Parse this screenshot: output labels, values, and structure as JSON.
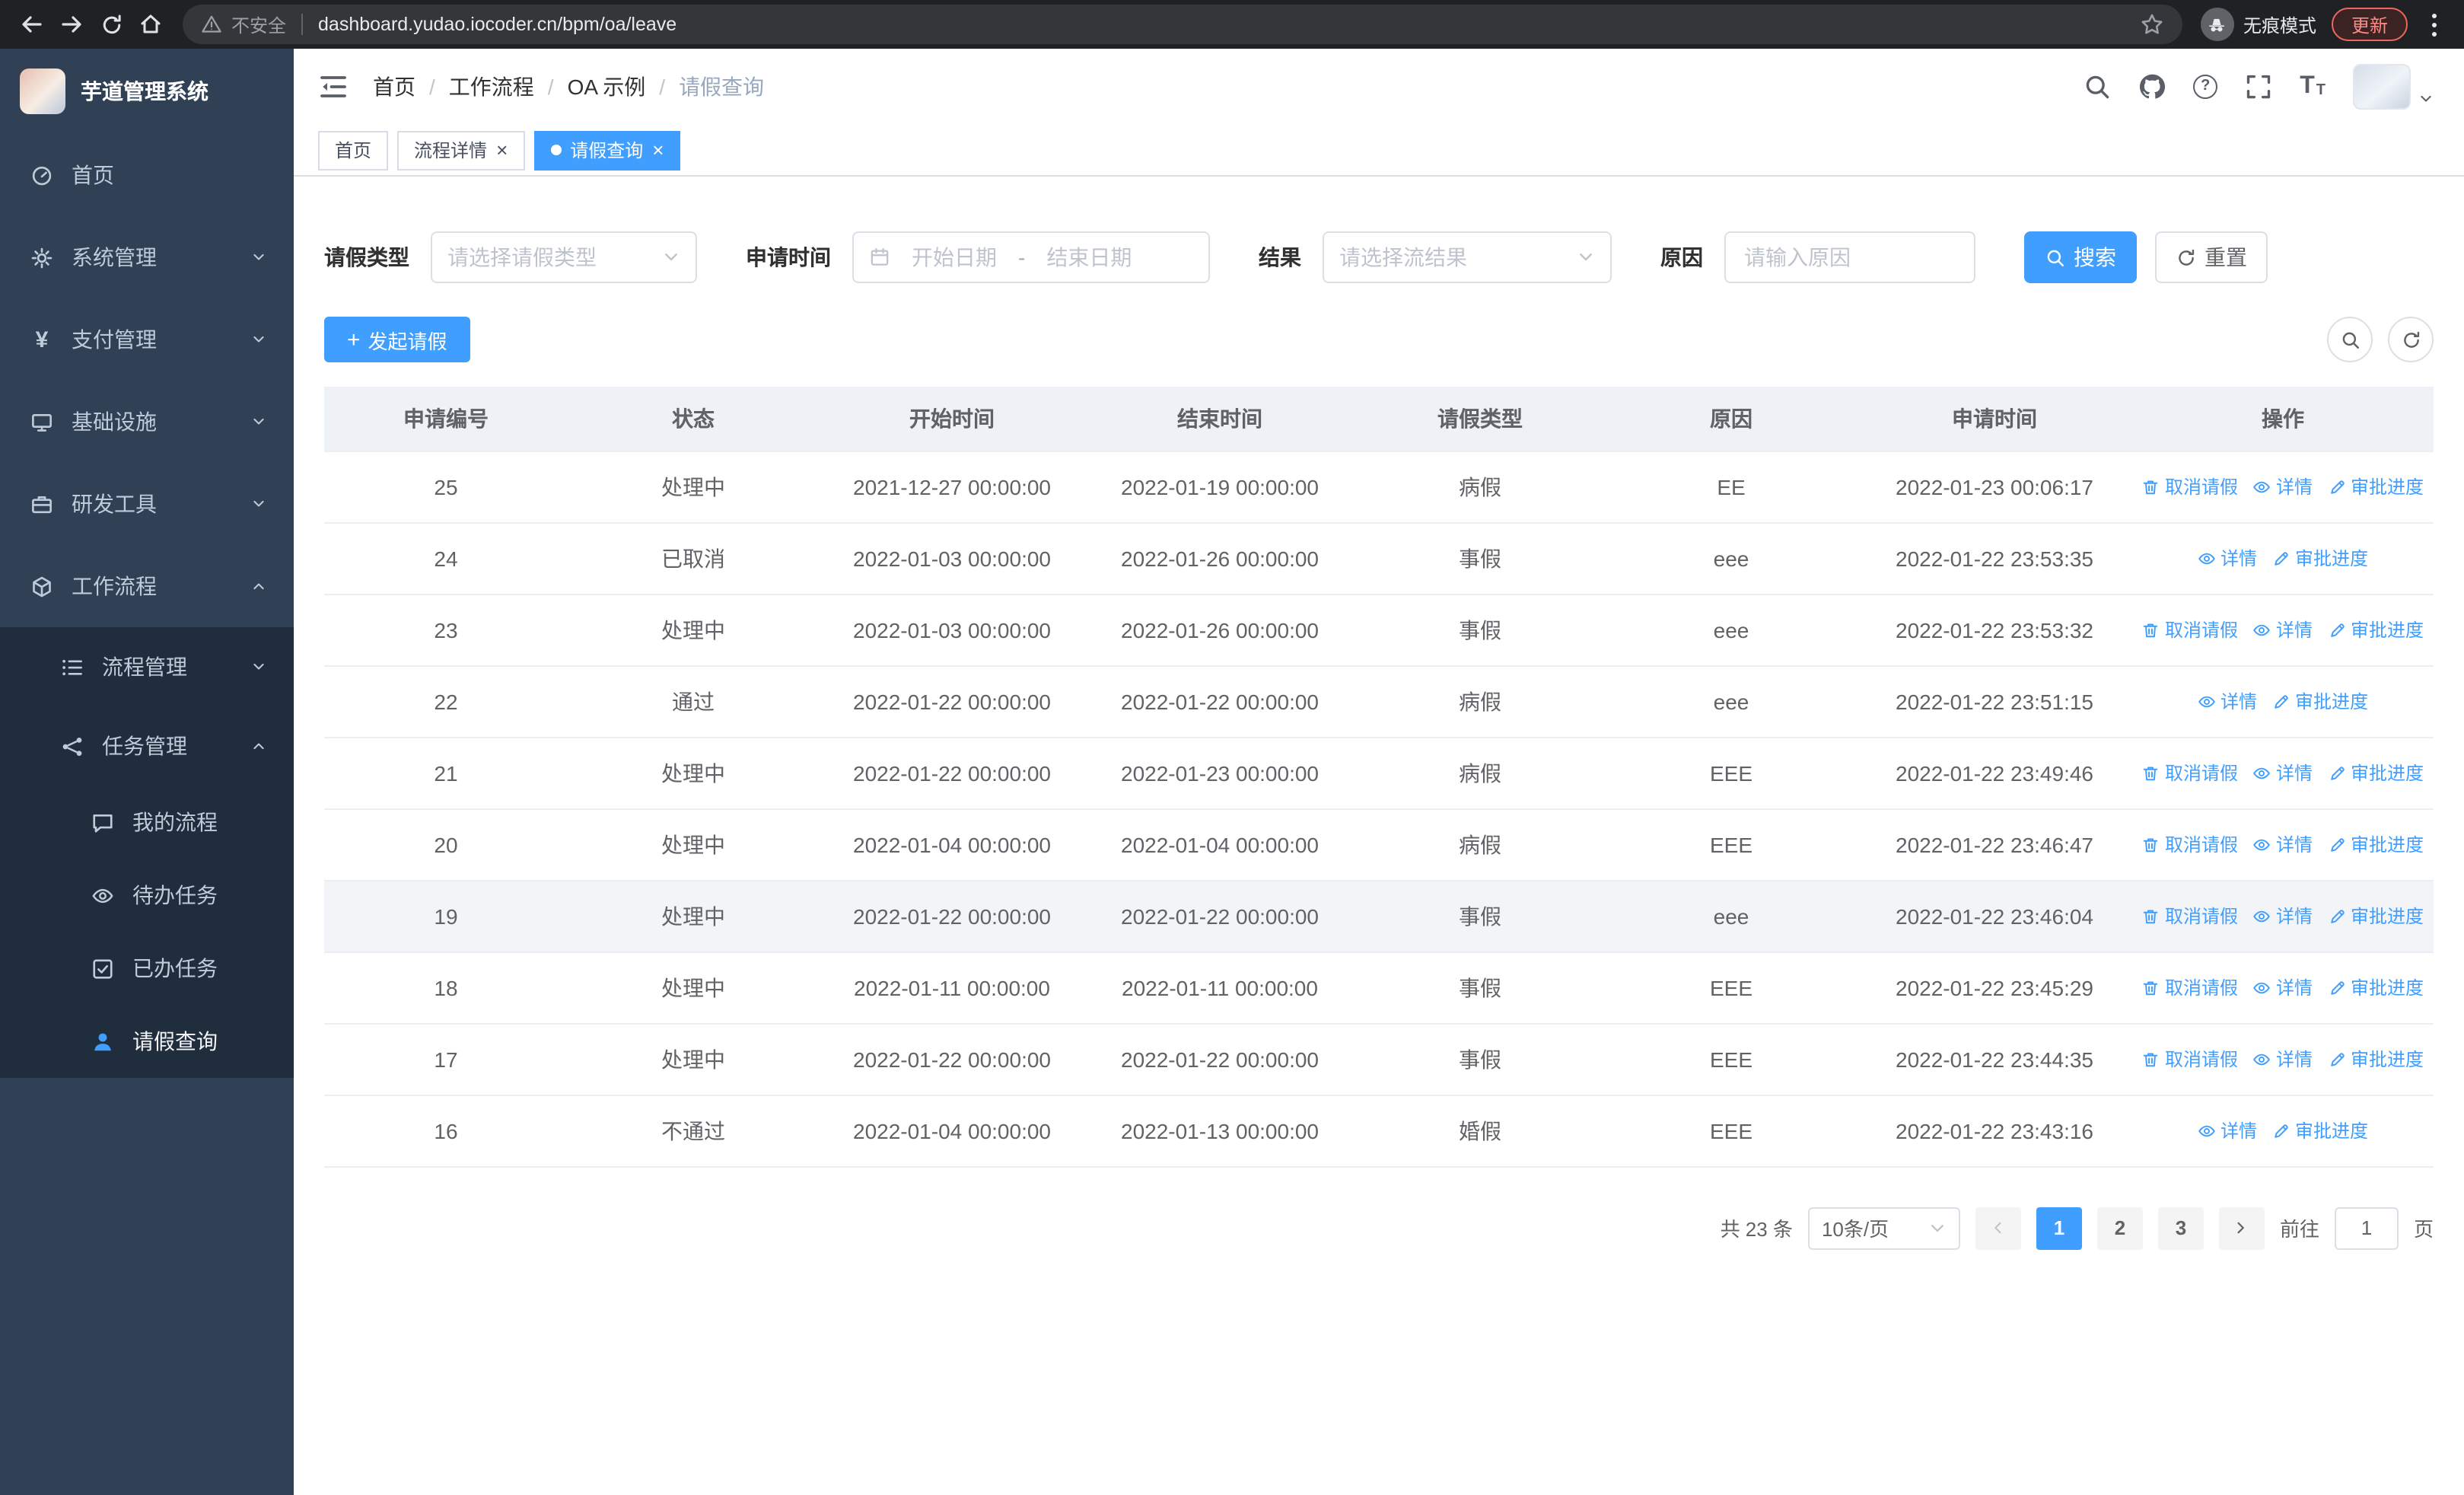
{
  "browser": {
    "security_label": "不安全",
    "url": "dashboard.yudao.iocoder.cn/bpm/oa/leave",
    "incognito_label": "无痕模式",
    "update_label": "更新"
  },
  "sidebar": {
    "brand": "芋道管理系统",
    "items": {
      "home": "首页",
      "system": "系统管理",
      "payment": "支付管理",
      "infra": "基础设施",
      "devtools": "研发工具",
      "workflow": "工作流程",
      "process_mgmt": "流程管理",
      "task_mgmt": "任务管理",
      "my_process": "我的流程",
      "todo_tasks": "待办任务",
      "done_tasks": "已办任务",
      "leave_query": "请假查询"
    }
  },
  "header": {
    "breadcrumb": [
      "首页",
      "工作流程",
      "OA 示例",
      "请假查询"
    ]
  },
  "tabs": {
    "home": "首页",
    "process_detail": "流程详情",
    "leave_query": "请假查询"
  },
  "filters": {
    "leave_type_label": "请假类型",
    "leave_type_placeholder": "请选择请假类型",
    "apply_time_label": "申请时间",
    "date_start_placeholder": "开始日期",
    "date_separator": "-",
    "date_end_placeholder": "结束日期",
    "result_label": "结果",
    "result_placeholder": "请选择流结果",
    "reason_label": "原因",
    "reason_placeholder": "请输入原因",
    "search_label": "搜索",
    "reset_label": "重置"
  },
  "toolbar": {
    "create_label": "发起请假"
  },
  "table": {
    "columns": [
      "申请编号",
      "状态",
      "开始时间",
      "结束时间",
      "请假类型",
      "原因",
      "申请时间",
      "操作"
    ],
    "action_labels": {
      "cancel": "取消请假",
      "detail": "详情",
      "progress": "审批进度"
    },
    "rows": [
      {
        "id": "25",
        "status": "处理中",
        "start_time": "2021-12-27 00:00:00",
        "end_time": "2022-01-19 00:00:00",
        "leave_type": "病假",
        "reason": "EE",
        "apply_time": "2022-01-23 00:06:17",
        "actions": [
          "cancel",
          "detail",
          "progress"
        ]
      },
      {
        "id": "24",
        "status": "已取消",
        "start_time": "2022-01-03 00:00:00",
        "end_time": "2022-01-26 00:00:00",
        "leave_type": "事假",
        "reason": "eee",
        "apply_time": "2022-01-22 23:53:35",
        "actions": [
          "detail",
          "progress"
        ]
      },
      {
        "id": "23",
        "status": "处理中",
        "start_time": "2022-01-03 00:00:00",
        "end_time": "2022-01-26 00:00:00",
        "leave_type": "事假",
        "reason": "eee",
        "apply_time": "2022-01-22 23:53:32",
        "actions": [
          "cancel",
          "detail",
          "progress"
        ]
      },
      {
        "id": "22",
        "status": "通过",
        "start_time": "2022-01-22 00:00:00",
        "end_time": "2022-01-22 00:00:00",
        "leave_type": "病假",
        "reason": "eee",
        "apply_time": "2022-01-22 23:51:15",
        "actions": [
          "detail",
          "progress"
        ]
      },
      {
        "id": "21",
        "status": "处理中",
        "start_time": "2022-01-22 00:00:00",
        "end_time": "2022-01-23 00:00:00",
        "leave_type": "病假",
        "reason": "EEE",
        "apply_time": "2022-01-22 23:49:46",
        "actions": [
          "cancel",
          "detail",
          "progress"
        ]
      },
      {
        "id": "20",
        "status": "处理中",
        "start_time": "2022-01-04 00:00:00",
        "end_time": "2022-01-04 00:00:00",
        "leave_type": "病假",
        "reason": "EEE",
        "apply_time": "2022-01-22 23:46:47",
        "actions": [
          "cancel",
          "detail",
          "progress"
        ]
      },
      {
        "id": "19",
        "status": "处理中",
        "start_time": "2022-01-22 00:00:00",
        "end_time": "2022-01-22 00:00:00",
        "leave_type": "事假",
        "reason": "eee",
        "apply_time": "2022-01-22 23:46:04",
        "actions": [
          "cancel",
          "detail",
          "progress"
        ],
        "highlighted": true
      },
      {
        "id": "18",
        "status": "处理中",
        "start_time": "2022-01-11 00:00:00",
        "end_time": "2022-01-11 00:00:00",
        "leave_type": "事假",
        "reason": "EEE",
        "apply_time": "2022-01-22 23:45:29",
        "actions": [
          "cancel",
          "detail",
          "progress"
        ]
      },
      {
        "id": "17",
        "status": "处理中",
        "start_time": "2022-01-22 00:00:00",
        "end_time": "2022-01-22 00:00:00",
        "leave_type": "事假",
        "reason": "EEE",
        "apply_time": "2022-01-22 23:44:35",
        "actions": [
          "cancel",
          "detail",
          "progress"
        ]
      },
      {
        "id": "16",
        "status": "不通过",
        "start_time": "2022-01-04 00:00:00",
        "end_time": "2022-01-13 00:00:00",
        "leave_type": "婚假",
        "reason": "EEE",
        "apply_time": "2022-01-22 23:43:16",
        "actions": [
          "detail",
          "progress"
        ]
      }
    ]
  },
  "pagination": {
    "total_label": "共 23 条",
    "page_size": "10条/页",
    "pages": [
      "1",
      "2",
      "3"
    ],
    "current_page": "1",
    "goto_label": "前往",
    "goto_value": "1",
    "goto_unit": "页"
  },
  "icons": {
    "close": "×",
    "plus": "+",
    "question": "?",
    "yen": "¥",
    "font_large": "T",
    "font_small": "T"
  },
  "colors": {
    "primary": "#409EFF",
    "sidebar_bg": "#304156",
    "sidebar_submenu_bg": "#1f2d3d"
  }
}
